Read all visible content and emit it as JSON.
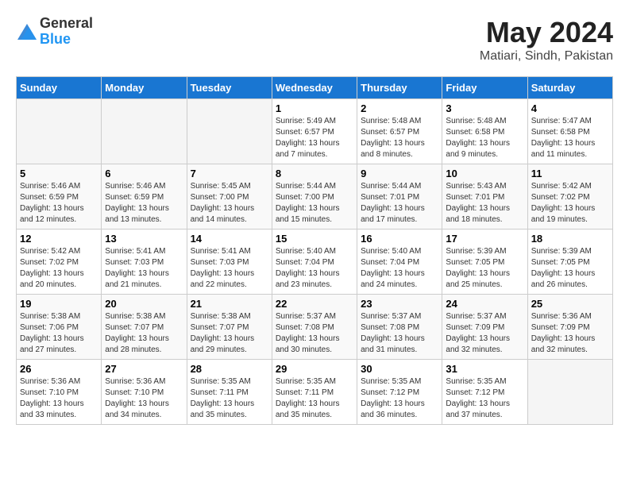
{
  "header": {
    "logo_general": "General",
    "logo_blue": "Blue",
    "month_title": "May 2024",
    "location": "Matiari, Sindh, Pakistan"
  },
  "weekdays": [
    "Sunday",
    "Monday",
    "Tuesday",
    "Wednesday",
    "Thursday",
    "Friday",
    "Saturday"
  ],
  "weeks": [
    [
      {
        "day": "",
        "sunrise": "",
        "sunset": "",
        "daylight": ""
      },
      {
        "day": "",
        "sunrise": "",
        "sunset": "",
        "daylight": ""
      },
      {
        "day": "",
        "sunrise": "",
        "sunset": "",
        "daylight": ""
      },
      {
        "day": "1",
        "sunrise": "Sunrise: 5:49 AM",
        "sunset": "Sunset: 6:57 PM",
        "daylight": "Daylight: 13 hours and 7 minutes."
      },
      {
        "day": "2",
        "sunrise": "Sunrise: 5:48 AM",
        "sunset": "Sunset: 6:57 PM",
        "daylight": "Daylight: 13 hours and 8 minutes."
      },
      {
        "day": "3",
        "sunrise": "Sunrise: 5:48 AM",
        "sunset": "Sunset: 6:58 PM",
        "daylight": "Daylight: 13 hours and 9 minutes."
      },
      {
        "day": "4",
        "sunrise": "Sunrise: 5:47 AM",
        "sunset": "Sunset: 6:58 PM",
        "daylight": "Daylight: 13 hours and 11 minutes."
      }
    ],
    [
      {
        "day": "5",
        "sunrise": "Sunrise: 5:46 AM",
        "sunset": "Sunset: 6:59 PM",
        "daylight": "Daylight: 13 hours and 12 minutes."
      },
      {
        "day": "6",
        "sunrise": "Sunrise: 5:46 AM",
        "sunset": "Sunset: 6:59 PM",
        "daylight": "Daylight: 13 hours and 13 minutes."
      },
      {
        "day": "7",
        "sunrise": "Sunrise: 5:45 AM",
        "sunset": "Sunset: 7:00 PM",
        "daylight": "Daylight: 13 hours and 14 minutes."
      },
      {
        "day": "8",
        "sunrise": "Sunrise: 5:44 AM",
        "sunset": "Sunset: 7:00 PM",
        "daylight": "Daylight: 13 hours and 15 minutes."
      },
      {
        "day": "9",
        "sunrise": "Sunrise: 5:44 AM",
        "sunset": "Sunset: 7:01 PM",
        "daylight": "Daylight: 13 hours and 17 minutes."
      },
      {
        "day": "10",
        "sunrise": "Sunrise: 5:43 AM",
        "sunset": "Sunset: 7:01 PM",
        "daylight": "Daylight: 13 hours and 18 minutes."
      },
      {
        "day": "11",
        "sunrise": "Sunrise: 5:42 AM",
        "sunset": "Sunset: 7:02 PM",
        "daylight": "Daylight: 13 hours and 19 minutes."
      }
    ],
    [
      {
        "day": "12",
        "sunrise": "Sunrise: 5:42 AM",
        "sunset": "Sunset: 7:02 PM",
        "daylight": "Daylight: 13 hours and 20 minutes."
      },
      {
        "day": "13",
        "sunrise": "Sunrise: 5:41 AM",
        "sunset": "Sunset: 7:03 PM",
        "daylight": "Daylight: 13 hours and 21 minutes."
      },
      {
        "day": "14",
        "sunrise": "Sunrise: 5:41 AM",
        "sunset": "Sunset: 7:03 PM",
        "daylight": "Daylight: 13 hours and 22 minutes."
      },
      {
        "day": "15",
        "sunrise": "Sunrise: 5:40 AM",
        "sunset": "Sunset: 7:04 PM",
        "daylight": "Daylight: 13 hours and 23 minutes."
      },
      {
        "day": "16",
        "sunrise": "Sunrise: 5:40 AM",
        "sunset": "Sunset: 7:04 PM",
        "daylight": "Daylight: 13 hours and 24 minutes."
      },
      {
        "day": "17",
        "sunrise": "Sunrise: 5:39 AM",
        "sunset": "Sunset: 7:05 PM",
        "daylight": "Daylight: 13 hours and 25 minutes."
      },
      {
        "day": "18",
        "sunrise": "Sunrise: 5:39 AM",
        "sunset": "Sunset: 7:05 PM",
        "daylight": "Daylight: 13 hours and 26 minutes."
      }
    ],
    [
      {
        "day": "19",
        "sunrise": "Sunrise: 5:38 AM",
        "sunset": "Sunset: 7:06 PM",
        "daylight": "Daylight: 13 hours and 27 minutes."
      },
      {
        "day": "20",
        "sunrise": "Sunrise: 5:38 AM",
        "sunset": "Sunset: 7:07 PM",
        "daylight": "Daylight: 13 hours and 28 minutes."
      },
      {
        "day": "21",
        "sunrise": "Sunrise: 5:38 AM",
        "sunset": "Sunset: 7:07 PM",
        "daylight": "Daylight: 13 hours and 29 minutes."
      },
      {
        "day": "22",
        "sunrise": "Sunrise: 5:37 AM",
        "sunset": "Sunset: 7:08 PM",
        "daylight": "Daylight: 13 hours and 30 minutes."
      },
      {
        "day": "23",
        "sunrise": "Sunrise: 5:37 AM",
        "sunset": "Sunset: 7:08 PM",
        "daylight": "Daylight: 13 hours and 31 minutes."
      },
      {
        "day": "24",
        "sunrise": "Sunrise: 5:37 AM",
        "sunset": "Sunset: 7:09 PM",
        "daylight": "Daylight: 13 hours and 32 minutes."
      },
      {
        "day": "25",
        "sunrise": "Sunrise: 5:36 AM",
        "sunset": "Sunset: 7:09 PM",
        "daylight": "Daylight: 13 hours and 32 minutes."
      }
    ],
    [
      {
        "day": "26",
        "sunrise": "Sunrise: 5:36 AM",
        "sunset": "Sunset: 7:10 PM",
        "daylight": "Daylight: 13 hours and 33 minutes."
      },
      {
        "day": "27",
        "sunrise": "Sunrise: 5:36 AM",
        "sunset": "Sunset: 7:10 PM",
        "daylight": "Daylight: 13 hours and 34 minutes."
      },
      {
        "day": "28",
        "sunrise": "Sunrise: 5:35 AM",
        "sunset": "Sunset: 7:11 PM",
        "daylight": "Daylight: 13 hours and 35 minutes."
      },
      {
        "day": "29",
        "sunrise": "Sunrise: 5:35 AM",
        "sunset": "Sunset: 7:11 PM",
        "daylight": "Daylight: 13 hours and 35 minutes."
      },
      {
        "day": "30",
        "sunrise": "Sunrise: 5:35 AM",
        "sunset": "Sunset: 7:12 PM",
        "daylight": "Daylight: 13 hours and 36 minutes."
      },
      {
        "day": "31",
        "sunrise": "Sunrise: 5:35 AM",
        "sunset": "Sunset: 7:12 PM",
        "daylight": "Daylight: 13 hours and 37 minutes."
      },
      {
        "day": "",
        "sunrise": "",
        "sunset": "",
        "daylight": ""
      }
    ]
  ]
}
